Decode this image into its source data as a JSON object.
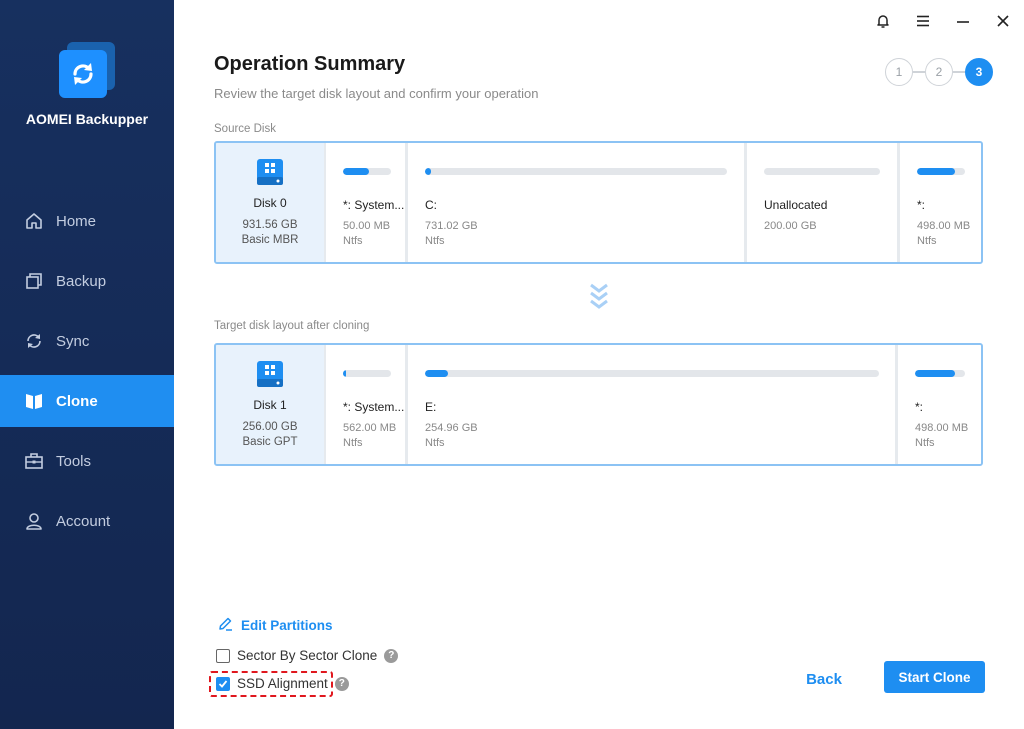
{
  "app": {
    "name": "AOMEI Backupper"
  },
  "sidebar": {
    "items": [
      {
        "label": "Home",
        "icon": "home-icon"
      },
      {
        "label": "Backup",
        "icon": "backup-icon"
      },
      {
        "label": "Sync",
        "icon": "sync-icon"
      },
      {
        "label": "Clone",
        "icon": "clone-icon",
        "active": true
      },
      {
        "label": "Tools",
        "icon": "tools-icon"
      },
      {
        "label": "Account",
        "icon": "account-icon"
      }
    ]
  },
  "titlebar": {
    "icons": [
      "bell-icon",
      "menu-icon",
      "minimize-icon",
      "close-icon"
    ]
  },
  "page": {
    "title": "Operation Summary",
    "subtitle": "Review the target disk layout and confirm your operation"
  },
  "steps": [
    "1",
    "2",
    "3"
  ],
  "active_step": 3,
  "source": {
    "label": "Source Disk",
    "disk": {
      "name": "Disk 0",
      "size": "931.56 GB",
      "type": "Basic MBR"
    },
    "partitions": [
      {
        "name": "*: System...",
        "size": "50.00 MB",
        "fs": "Ntfs",
        "fill": 0.55
      },
      {
        "name": "C:",
        "size": "731.02 GB",
        "fs": "Ntfs",
        "fill": 0.02
      },
      {
        "name": "Unallocated",
        "size": "200.00 GB",
        "fs": "",
        "fill": 0
      },
      {
        "name": "*:",
        "size": "498.00 MB",
        "fs": "Ntfs",
        "fill": 0.8
      }
    ]
  },
  "target": {
    "label": "Target disk layout after cloning",
    "disk": {
      "name": "Disk 1",
      "size": "256.00 GB",
      "type": "Basic GPT"
    },
    "partitions": [
      {
        "name": "*: System...",
        "size": "562.00 MB",
        "fs": "Ntfs",
        "fill": 0.06
      },
      {
        "name": "E:",
        "size": "254.96 GB",
        "fs": "Ntfs",
        "fill": 0.05
      },
      {
        "name": "*:",
        "size": "498.00 MB",
        "fs": "Ntfs",
        "fill": 0.8
      }
    ]
  },
  "options": {
    "edit_partitions": "Edit Partitions",
    "sector_by_sector": {
      "label": "Sector By Sector Clone",
      "checked": false
    },
    "ssd_alignment": {
      "label": "SSD Alignment",
      "checked": true
    },
    "help_glyph": "?"
  },
  "buttons": {
    "back": "Back",
    "start": "Start Clone"
  },
  "colors": {
    "accent": "#1e8ef1",
    "sidebar": "#17305f",
    "highlight": "#e0171e"
  }
}
